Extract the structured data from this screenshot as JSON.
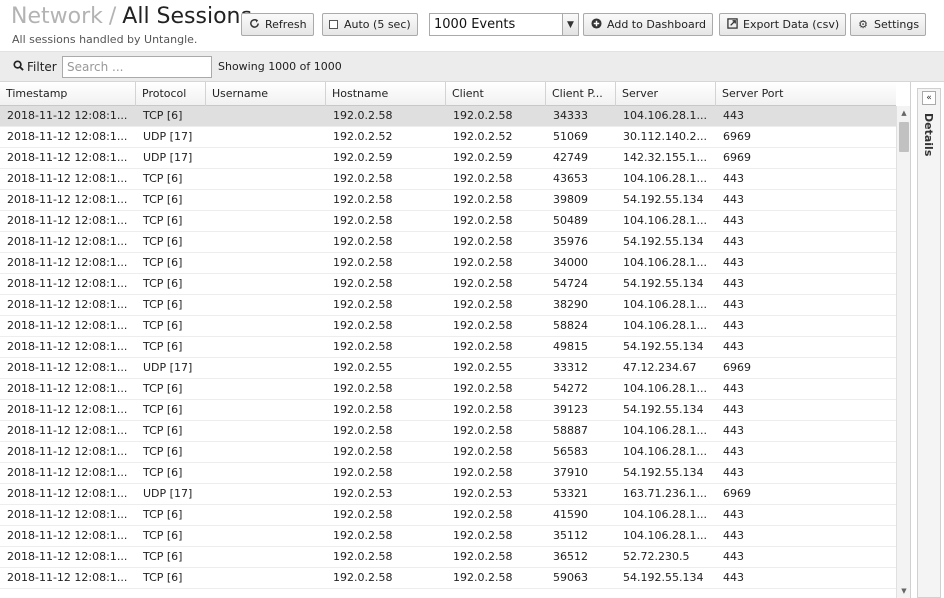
{
  "header": {
    "breadcrumb_parent": "Network",
    "breadcrumb_sep": "/",
    "title": "All Sessions",
    "subtitle": "All sessions handled by Untangle."
  },
  "toolbar": {
    "refresh_label": "Refresh",
    "auto_label": "Auto (5 sec)",
    "events_value": "1000 Events",
    "add_dashboard_label": "Add to Dashboard",
    "export_label": "Export Data (csv)",
    "settings_label": "Settings"
  },
  "filter": {
    "label": "Filter",
    "placeholder": "Search ...",
    "showing": "Showing 1000 of 1000"
  },
  "grid": {
    "columns": [
      "Timestamp",
      "Protocol",
      "Username",
      "Hostname",
      "Client",
      "Client P...",
      "Server",
      "Server Port"
    ],
    "rows": [
      [
        "2018-11-12 12:08:1...",
        "TCP [6]",
        "",
        "192.0.2.58",
        "192.0.2.58",
        "34333",
        "104.106.28.1...",
        "443"
      ],
      [
        "2018-11-12 12:08:1...",
        "UDP [17]",
        "",
        "192.0.2.52",
        "192.0.2.52",
        "51069",
        "30.112.140.2...",
        "6969"
      ],
      [
        "2018-11-12 12:08:1...",
        "UDP [17]",
        "",
        "192.0.2.59",
        "192.0.2.59",
        "42749",
        "142.32.155.1...",
        "6969"
      ],
      [
        "2018-11-12 12:08:1...",
        "TCP [6]",
        "",
        "192.0.2.58",
        "192.0.2.58",
        "43653",
        "104.106.28.1...",
        "443"
      ],
      [
        "2018-11-12 12:08:1...",
        "TCP [6]",
        "",
        "192.0.2.58",
        "192.0.2.58",
        "39809",
        "54.192.55.134",
        "443"
      ],
      [
        "2018-11-12 12:08:1...",
        "TCP [6]",
        "",
        "192.0.2.58",
        "192.0.2.58",
        "50489",
        "104.106.28.1...",
        "443"
      ],
      [
        "2018-11-12 12:08:1...",
        "TCP [6]",
        "",
        "192.0.2.58",
        "192.0.2.58",
        "35976",
        "54.192.55.134",
        "443"
      ],
      [
        "2018-11-12 12:08:1...",
        "TCP [6]",
        "",
        "192.0.2.58",
        "192.0.2.58",
        "34000",
        "104.106.28.1...",
        "443"
      ],
      [
        "2018-11-12 12:08:1...",
        "TCP [6]",
        "",
        "192.0.2.58",
        "192.0.2.58",
        "54724",
        "54.192.55.134",
        "443"
      ],
      [
        "2018-11-12 12:08:1...",
        "TCP [6]",
        "",
        "192.0.2.58",
        "192.0.2.58",
        "38290",
        "104.106.28.1...",
        "443"
      ],
      [
        "2018-11-12 12:08:1...",
        "TCP [6]",
        "",
        "192.0.2.58",
        "192.0.2.58",
        "58824",
        "104.106.28.1...",
        "443"
      ],
      [
        "2018-11-12 12:08:1...",
        "TCP [6]",
        "",
        "192.0.2.58",
        "192.0.2.58",
        "49815",
        "54.192.55.134",
        "443"
      ],
      [
        "2018-11-12 12:08:1...",
        "UDP [17]",
        "",
        "192.0.2.55",
        "192.0.2.55",
        "33312",
        "47.12.234.67",
        "6969"
      ],
      [
        "2018-11-12 12:08:1...",
        "TCP [6]",
        "",
        "192.0.2.58",
        "192.0.2.58",
        "54272",
        "104.106.28.1...",
        "443"
      ],
      [
        "2018-11-12 12:08:1...",
        "TCP [6]",
        "",
        "192.0.2.58",
        "192.0.2.58",
        "39123",
        "54.192.55.134",
        "443"
      ],
      [
        "2018-11-12 12:08:1...",
        "TCP [6]",
        "",
        "192.0.2.58",
        "192.0.2.58",
        "58887",
        "104.106.28.1...",
        "443"
      ],
      [
        "2018-11-12 12:08:1...",
        "TCP [6]",
        "",
        "192.0.2.58",
        "192.0.2.58",
        "56583",
        "104.106.28.1...",
        "443"
      ],
      [
        "2018-11-12 12:08:1...",
        "TCP [6]",
        "",
        "192.0.2.58",
        "192.0.2.58",
        "37910",
        "54.192.55.134",
        "443"
      ],
      [
        "2018-11-12 12:08:1...",
        "UDP [17]",
        "",
        "192.0.2.53",
        "192.0.2.53",
        "53321",
        "163.71.236.1...",
        "6969"
      ],
      [
        "2018-11-12 12:08:1...",
        "TCP [6]",
        "",
        "192.0.2.58",
        "192.0.2.58",
        "41590",
        "104.106.28.1...",
        "443"
      ],
      [
        "2018-11-12 12:08:1...",
        "TCP [6]",
        "",
        "192.0.2.58",
        "192.0.2.58",
        "35112",
        "104.106.28.1...",
        "443"
      ],
      [
        "2018-11-12 12:08:1...",
        "TCP [6]",
        "",
        "192.0.2.58",
        "192.0.2.58",
        "36512",
        "52.72.230.5",
        "443"
      ],
      [
        "2018-11-12 12:08:1...",
        "TCP [6]",
        "",
        "192.0.2.58",
        "192.0.2.58",
        "59063",
        "54.192.55.134",
        "443"
      ]
    ]
  },
  "details": {
    "label": "Details"
  },
  "icons": {
    "refresh": "refresh-icon",
    "add": "plus-circle-icon",
    "export": "export-icon",
    "settings": "gear-icon",
    "search": "search-icon",
    "collapse": "double-chevron-left-icon"
  }
}
